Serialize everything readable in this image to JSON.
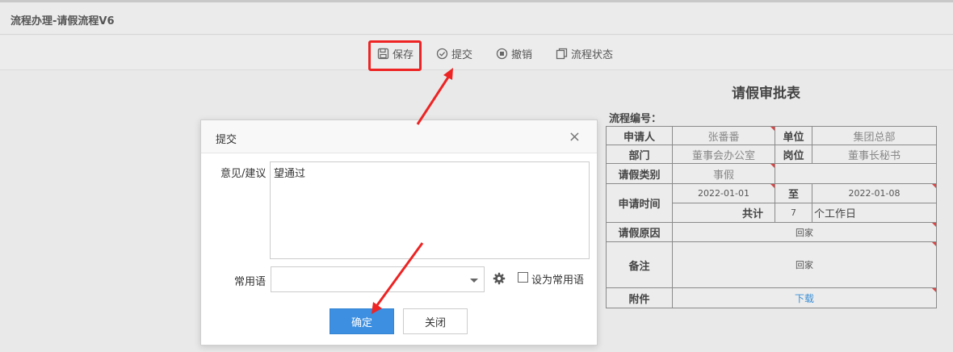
{
  "page": {
    "title": "流程办理-请假流程V6"
  },
  "toolbar": {
    "save": "保存",
    "submit": "提交",
    "revoke": "撤销",
    "status": "流程状态"
  },
  "form": {
    "title": "请假审批表",
    "flow_no_label": "流程编号：",
    "applicant_label": "申请人",
    "applicant": "张番番",
    "unit_label": "单位",
    "unit": "集团总部",
    "dept_label": "部门",
    "dept": "董事会办公室",
    "post_label": "岗位",
    "post": "董事长秘书",
    "type_label": "请假类别",
    "type": "事假",
    "time_label": "申请时间",
    "start_date": "2022-01-01",
    "to_label": "至",
    "end_date": "2022-01-08",
    "total_label": "共计",
    "total_days": "7",
    "days_unit": "个工作日",
    "reason_label": "请假原因",
    "reason": "回家",
    "remark_label": "备注",
    "remark": "回家",
    "attach_label": "附件",
    "attach_link": "下载"
  },
  "dialog": {
    "title": "提交",
    "close_glyph": "×",
    "opinion_label": "意见/建议",
    "opinion_value": "望通过",
    "common_label": "常用语",
    "common_value": "",
    "set_common_label": "设为常用语",
    "ok_label": "确定",
    "close_label": "关闭"
  },
  "colors": {
    "highlight": "#ee2323",
    "primary": "#3d8fe1",
    "link": "#3a8fd6"
  },
  "icons": [
    "save-icon",
    "submit-check-icon",
    "revoke-icon",
    "status-copy-icon",
    "gear-icon"
  ]
}
